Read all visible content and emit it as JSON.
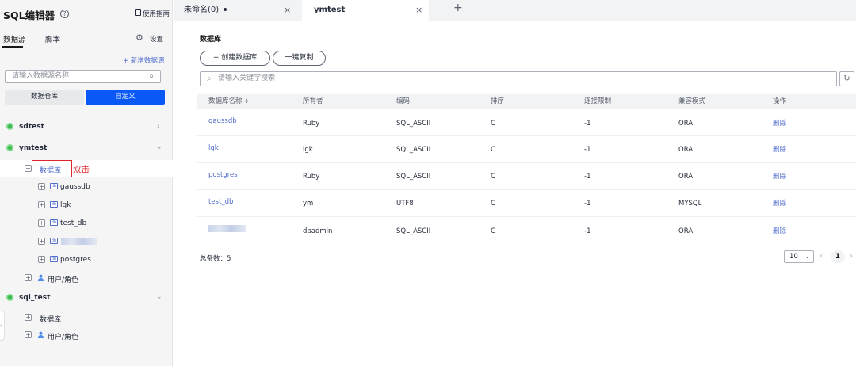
{
  "sidebar": {
    "title": "SQL编辑器",
    "guide_label": "使用指南",
    "tabs": [
      "数据源",
      "脚本"
    ],
    "settings_label": "设置",
    "add_datasource_label": "+ 新增数据源",
    "search_placeholder": "请输入数据源名称",
    "filter_buttons": [
      "数据仓库",
      "自定义"
    ],
    "tree": {
      "sdtest": "sdtest",
      "ymtest": "ymtest",
      "ymtest_db_folder": "数据库",
      "annotation": "双击",
      "ymtest_dbs": [
        "gaussdb",
        "lgk",
        "test_db",
        "",
        "postgres"
      ],
      "ymtest_users": "用户/角色",
      "sql_test": "sql_test",
      "sql_test_db_folder": "数据库",
      "sql_test_users": "用户/角色",
      "db_icon_text": "db"
    }
  },
  "tabs": [
    {
      "label": "未命名(0)"
    },
    {
      "label": "ymtest"
    }
  ],
  "main": {
    "section_title": "数据库",
    "create_button": "+ 创建数据库",
    "copy_button": "一键复制",
    "search_placeholder": "请输入关键字搜索",
    "columns": [
      "数据库名称",
      "所有者",
      "编码",
      "排序",
      "连接限制",
      "兼容模式",
      "操作"
    ],
    "rows": [
      {
        "name": "gaussdb",
        "owner": "Ruby",
        "encoding": "SQL_ASCII",
        "collate": "C",
        "limit": "-1",
        "mode": "ORA",
        "action": "删除"
      },
      {
        "name": "lgk",
        "owner": "lgk",
        "encoding": "SQL_ASCII",
        "collate": "C",
        "limit": "-1",
        "mode": "ORA",
        "action": "删除"
      },
      {
        "name": "postgres",
        "owner": "Ruby",
        "encoding": "SQL_ASCII",
        "collate": "C",
        "limit": "-1",
        "mode": "ORA",
        "action": "删除"
      },
      {
        "name": "test_db",
        "owner": "ym",
        "encoding": "UTF8",
        "collate": "C",
        "limit": "-1",
        "mode": "MYSQL",
        "action": "删除"
      },
      {
        "name": "",
        "owner": "dbadmin",
        "encoding": "SQL_ASCII",
        "collate": "C",
        "limit": "-1",
        "mode": "ORA",
        "action": "删除"
      }
    ],
    "total_label": "总条数：5",
    "page_size": "10",
    "current_page": "1"
  },
  "colors": {
    "link": "#526ecc",
    "primary": "#0a59f7",
    "annotation_red": "#e0242b",
    "connected_green": "#3fb950"
  }
}
